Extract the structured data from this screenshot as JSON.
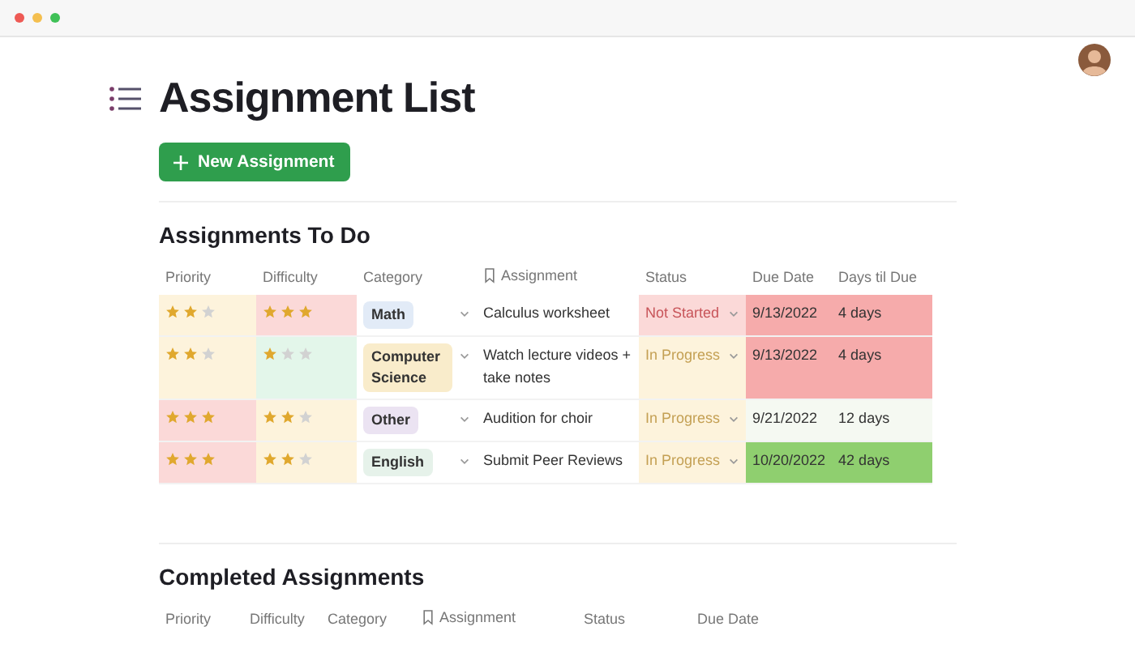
{
  "title": "Assignment List",
  "new_button": "New Assignment",
  "todo": {
    "heading": "Assignments To Do",
    "columns": [
      "Priority",
      "Difficulty",
      "Category",
      "Assignment",
      "Status",
      "Due Date",
      "Days til Due"
    ],
    "rows": [
      {
        "priority": {
          "stars": 2,
          "color": "#fdf3dc"
        },
        "difficulty": {
          "stars": 3,
          "color": "#fbd9d8"
        },
        "category": {
          "label": "Math",
          "color": "#e2ebf7"
        },
        "assignment": "Calculus worksheet",
        "status": {
          "label": "Not Started",
          "kind": "not_started",
          "color": "#fbd9d8"
        },
        "due": {
          "date": "9/13/2022",
          "days": "4 days",
          "color": "#f6abab"
        }
      },
      {
        "priority": {
          "stars": 2,
          "color": "#fdf3dc"
        },
        "difficulty": {
          "stars": 1,
          "color": "#e3f6ea"
        },
        "category": {
          "label": "Computer Science",
          "color": "#f9eccb"
        },
        "assignment": "Watch lecture videos + take notes",
        "status": {
          "label": "In Progress",
          "kind": "in_progress",
          "color": "#fdf3dc"
        },
        "due": {
          "date": "9/13/2022",
          "days": "4 days",
          "color": "#f6abab"
        }
      },
      {
        "priority": {
          "stars": 3,
          "color": "#fbd9d8"
        },
        "difficulty": {
          "stars": 2,
          "color": "#fdf3dc"
        },
        "category": {
          "label": "Other",
          "color": "#ebe3f2"
        },
        "assignment": "Audition for choir",
        "status": {
          "label": "In Progress",
          "kind": "in_progress",
          "color": "#fdf3dc"
        },
        "due": {
          "date": "9/21/2022",
          "days": "12 days",
          "color": "#f5f9f2"
        }
      },
      {
        "priority": {
          "stars": 3,
          "color": "#fbd9d8"
        },
        "difficulty": {
          "stars": 2,
          "color": "#fdf3dc"
        },
        "category": {
          "label": "English",
          "color": "#e6f2ea"
        },
        "assignment": "Submit Peer Reviews",
        "status": {
          "label": "In Progress",
          "kind": "in_progress",
          "color": "#fdf3dc"
        },
        "due": {
          "date": "10/20/2022",
          "days": "42 days",
          "color": "#8fcf6f"
        }
      }
    ]
  },
  "completed": {
    "heading": "Completed Assignments",
    "columns": [
      "Priority",
      "Difficulty",
      "Category",
      "Assignment",
      "Status",
      "Due Date"
    ]
  }
}
